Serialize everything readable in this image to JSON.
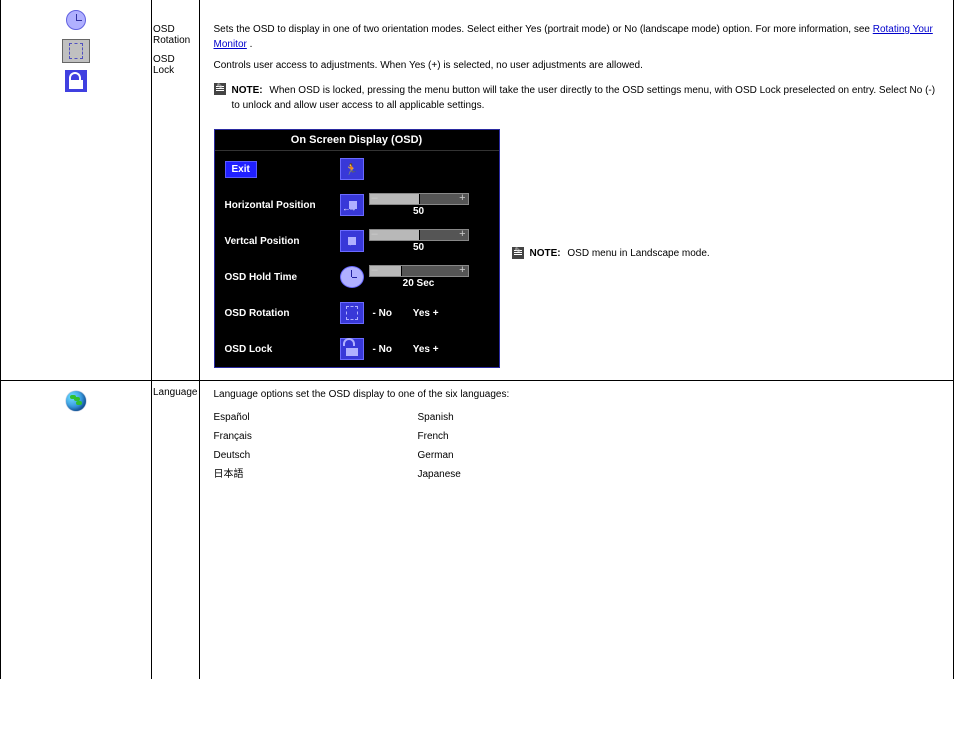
{
  "row1": {
    "col2_items": [
      {
        "name": "OSD Rotation"
      },
      {
        "name": "OSD Lock"
      }
    ],
    "desc": [
      {
        "type": "text",
        "value": "Sets the OSD to display in one of two orientation modes. Select either Yes (portrait mode) or No (landscape mode) "
      },
      {
        "type": "text",
        "value": "option. For more information, see "
      },
      {
        "type": "link",
        "value": "Rotating Your Monitor"
      },
      {
        "type": "text",
        "value": "."
      }
    ],
    "lock_desc": "Controls user access to adjustments. When Yes  (+) is selected, no user adjustments are allowed.",
    "note_label": "NOTE:",
    "note_text": "When OSD is locked, pressing the menu button will take the user directly to the OSD settings menu, with OSD Lock  preselected on entry. Select No (-)  to unlock and allow user access to all applicable settings.",
    "osd": {
      "title": "On Screen Display (OSD)",
      "rows": [
        {
          "label": "Exit",
          "icon": "run"
        },
        {
          "label": "Horizontal Position",
          "icon": "hpos",
          "slider": {
            "fill": 50,
            "value": "50"
          }
        },
        {
          "label": "Vertcal Position",
          "icon": "vpos",
          "slider": {
            "fill": 50,
            "value": "50"
          }
        },
        {
          "label": "OSD Hold Time",
          "icon": "clock",
          "slider": {
            "fill": 32,
            "value": "20 Sec"
          }
        },
        {
          "label": "OSD Rotation",
          "icon": "rot",
          "noyes": {
            "no": "-  No",
            "yes": "Yes +"
          }
        },
        {
          "label": "OSD Lock",
          "icon": "unlock",
          "noyes": {
            "no": "-  No",
            "yes": "Yes +"
          }
        }
      ]
    },
    "side_note_label": "NOTE:",
    "side_note_text": "OSD menu in Landscape mode."
  },
  "row2": {
    "col2": "Language",
    "intro": "Language options set the OSD display to one of the six languages:",
    "langs": [
      {
        "k": "Español",
        "v": "Spanish"
      },
      {
        "k": "Français",
        "v": "French"
      },
      {
        "k": "Deutsch",
        "v": "German"
      },
      {
        "k": "日本語",
        "v": "Japanese"
      }
    ]
  }
}
